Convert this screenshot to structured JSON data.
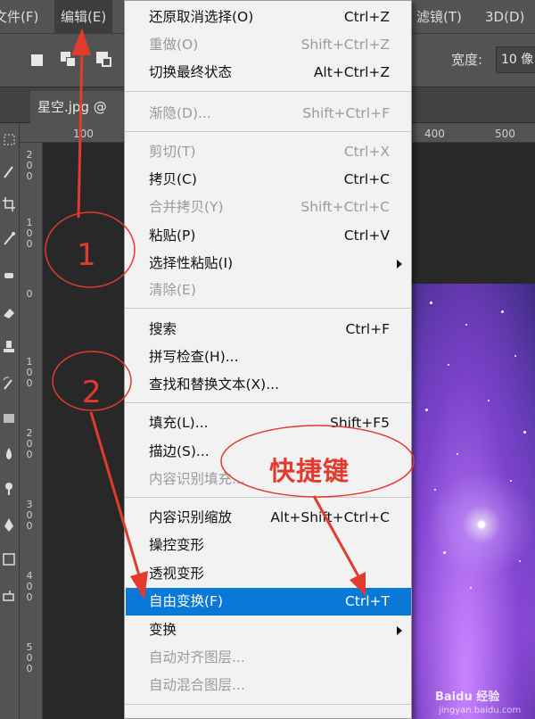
{
  "menubar": {
    "items": [
      "文件(F)",
      "编辑(E)",
      "滤镜(T)",
      "3D(D)"
    ]
  },
  "options": {
    "width_label": "宽度:",
    "width_value": "10 像"
  },
  "tab": {
    "title": "星空.jpg @"
  },
  "ruler": {
    "h_marks": [
      "100",
      "400",
      "500"
    ],
    "v_marks": [
      "2\n0\n0",
      "1\n0\n0",
      "0",
      "1\n0\n0",
      "2\n0\n0",
      "3\n0\n0",
      "4\n0\n0",
      "5\n0\n0"
    ]
  },
  "edit_menu": {
    "items": [
      {
        "label": "还原取消选择(O)",
        "shortcut": "Ctrl+Z",
        "disabled": false
      },
      {
        "label": "重做(O)",
        "shortcut": "Shift+Ctrl+Z",
        "disabled": true
      },
      {
        "label": "切换最终状态",
        "shortcut": "Alt+Ctrl+Z",
        "disabled": false
      },
      {
        "label": "渐隐(D)...",
        "shortcut": "Shift+Ctrl+F",
        "disabled": true
      },
      {
        "label": "剪切(T)",
        "shortcut": "Ctrl+X",
        "disabled": true
      },
      {
        "label": "拷贝(C)",
        "shortcut": "Ctrl+C",
        "disabled": false
      },
      {
        "label": "合并拷贝(Y)",
        "shortcut": "Shift+Ctrl+C",
        "disabled": true
      },
      {
        "label": "粘贴(P)",
        "shortcut": "Ctrl+V",
        "disabled": false
      },
      {
        "label": "选择性粘贴(I)",
        "shortcut": "",
        "disabled": false,
        "submenu": true
      },
      {
        "label": "清除(E)",
        "shortcut": "",
        "disabled": true
      },
      {
        "label": "搜索",
        "shortcut": "Ctrl+F",
        "disabled": false
      },
      {
        "label": "拼写检查(H)...",
        "shortcut": "",
        "disabled": false
      },
      {
        "label": "查找和替换文本(X)...",
        "shortcut": "",
        "disabled": false
      },
      {
        "label": "填充(L)...",
        "shortcut": "Shift+F5",
        "disabled": false
      },
      {
        "label": "描边(S)...",
        "shortcut": "",
        "disabled": false
      },
      {
        "label": "内容识别填充...",
        "shortcut": "",
        "disabled": true
      },
      {
        "label": "内容识别缩放",
        "shortcut": "Alt+Shift+Ctrl+C",
        "disabled": false
      },
      {
        "label": "操控变形",
        "shortcut": "",
        "disabled": false
      },
      {
        "label": "透视变形",
        "shortcut": "",
        "disabled": false
      },
      {
        "label": "自由变换(F)",
        "shortcut": "Ctrl+T",
        "disabled": false,
        "highlighted": true
      },
      {
        "label": "变换",
        "shortcut": "",
        "disabled": false,
        "submenu": true
      },
      {
        "label": "自动对齐图层...",
        "shortcut": "",
        "disabled": true
      },
      {
        "label": "自动混合图层...",
        "shortcut": "",
        "disabled": true
      }
    ]
  },
  "annotations": {
    "step1": "1",
    "step2": "2",
    "shortcut_note": "快捷键",
    "color": "#e23b2e"
  },
  "watermark": {
    "brand": "Baidu 经验",
    "url": "jingyan.baidu.com"
  },
  "colors": {
    "menu_highlight": "#0a78d7",
    "ui_dark": "#535353",
    "menu_bg": "#f2f2f2"
  }
}
